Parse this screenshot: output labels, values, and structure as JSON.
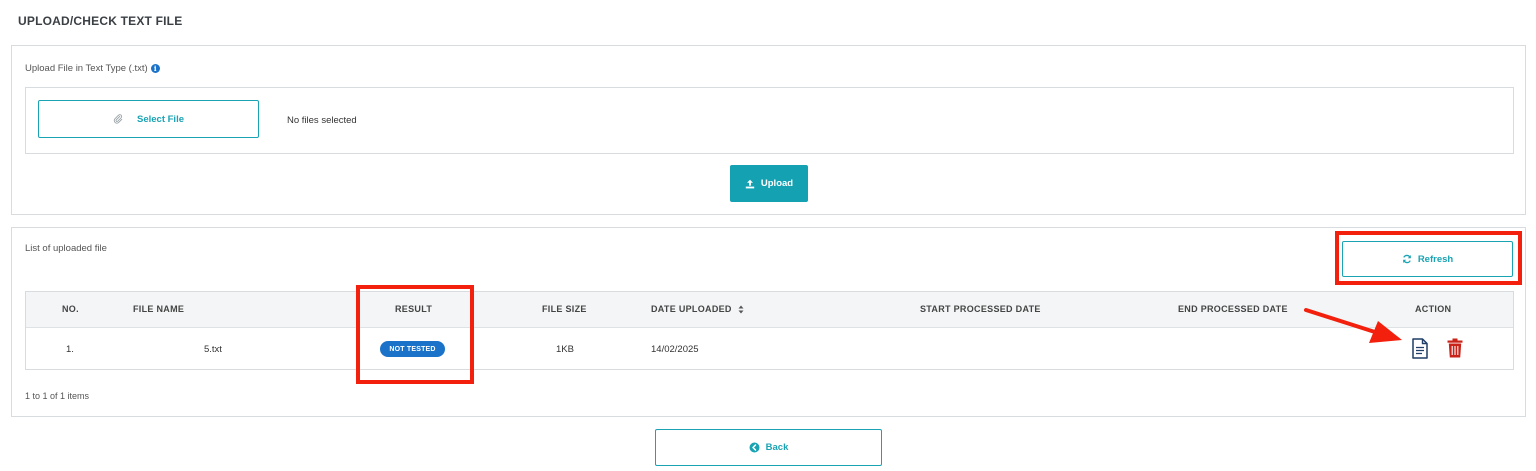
{
  "page": {
    "title": "UPLOAD/CHECK TEXT FILE"
  },
  "upload": {
    "label": "Upload File in Text Type (.txt)",
    "select_label": "Select File",
    "no_files_text": "No files selected",
    "upload_label": "Upload"
  },
  "list": {
    "label": "List of uploaded file",
    "refresh_label": "Refresh",
    "columns": [
      "NO.",
      "FILE NAME",
      "RESULT",
      "FILE SIZE",
      "DATE UPLOADED",
      "START PROCESSED DATE",
      "END PROCESSED DATE",
      "ACTION"
    ],
    "rows": [
      {
        "no": "1.",
        "file_name": "5.txt",
        "result": "NOT TESTED",
        "file_size": "1KB",
        "date_uploaded": "14/02/2025",
        "start_processed": "",
        "end_processed": ""
      }
    ],
    "pager_text": "1 to 1 of 1 items"
  },
  "footer": {
    "back_label": "Back"
  },
  "colors": {
    "accent": "#14a2b3",
    "badge": "#1a73c9",
    "delete": "#c9231a",
    "annotation": "#f2200d"
  },
  "icons": {
    "select": "paperclip-icon",
    "upload": "upload-icon",
    "refresh": "refresh-icon",
    "sort": "sort-icon",
    "view": "document-icon",
    "delete": "trash-icon",
    "back": "arrow-left-circle-icon",
    "info": "info-icon"
  }
}
